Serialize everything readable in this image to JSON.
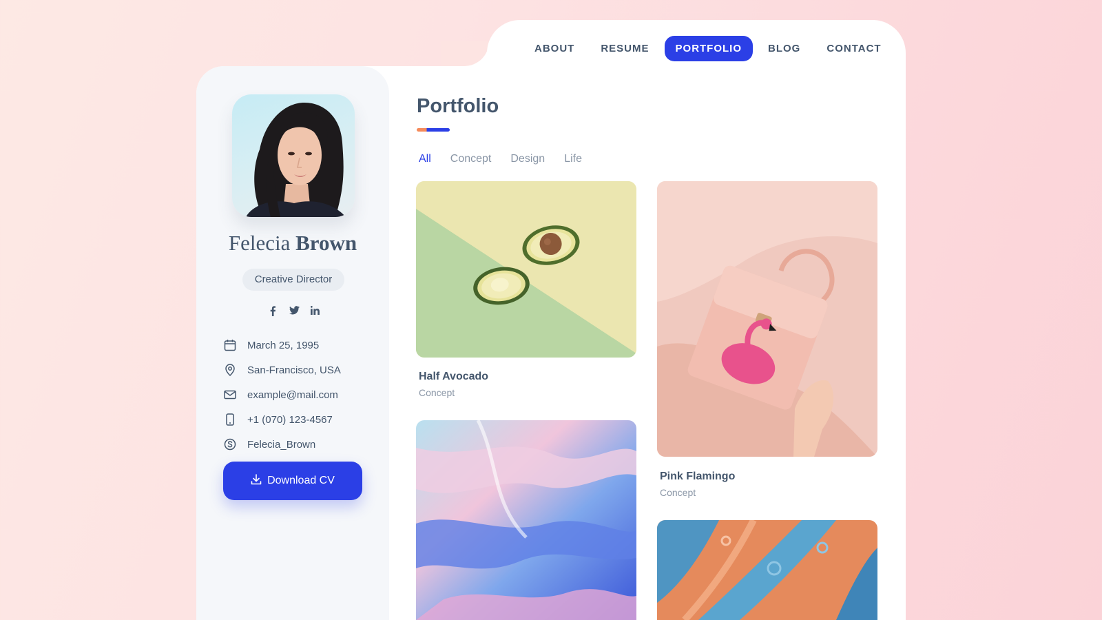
{
  "nav": {
    "items": [
      {
        "label": "ABOUT"
      },
      {
        "label": "RESUME"
      },
      {
        "label": "PORTFOLIO"
      },
      {
        "label": "BLOG"
      },
      {
        "label": "CONTACT"
      }
    ],
    "active": "PORTFOLIO"
  },
  "profile": {
    "first_name": "Felecia",
    "last_name": "Brown",
    "role": "Creative Director",
    "socials": [
      "facebook-icon",
      "twitter-icon",
      "linkedin-icon"
    ],
    "info": {
      "birthday": "March 25, 1995",
      "location": "San-Francisco, USA",
      "email": "example@mail.com",
      "phone": "+1 (070) 123-4567",
      "skype": "Felecia_Brown"
    },
    "download_label": "Download CV"
  },
  "portfolio": {
    "title": "Portfolio",
    "filters": [
      "All",
      "Concept",
      "Design",
      "Life"
    ],
    "active_filter": "All",
    "items": [
      {
        "title": "Half Avocado",
        "category": "Concept"
      },
      {
        "title": "Pink Flamingo",
        "category": "Concept"
      },
      {
        "title": "",
        "category": ""
      },
      {
        "title": "",
        "category": ""
      }
    ]
  },
  "colors": {
    "accent": "#2b3fe6",
    "text": "#44566c",
    "muted": "#8a96a6",
    "sidebar_bg": "#f5f7fa"
  }
}
